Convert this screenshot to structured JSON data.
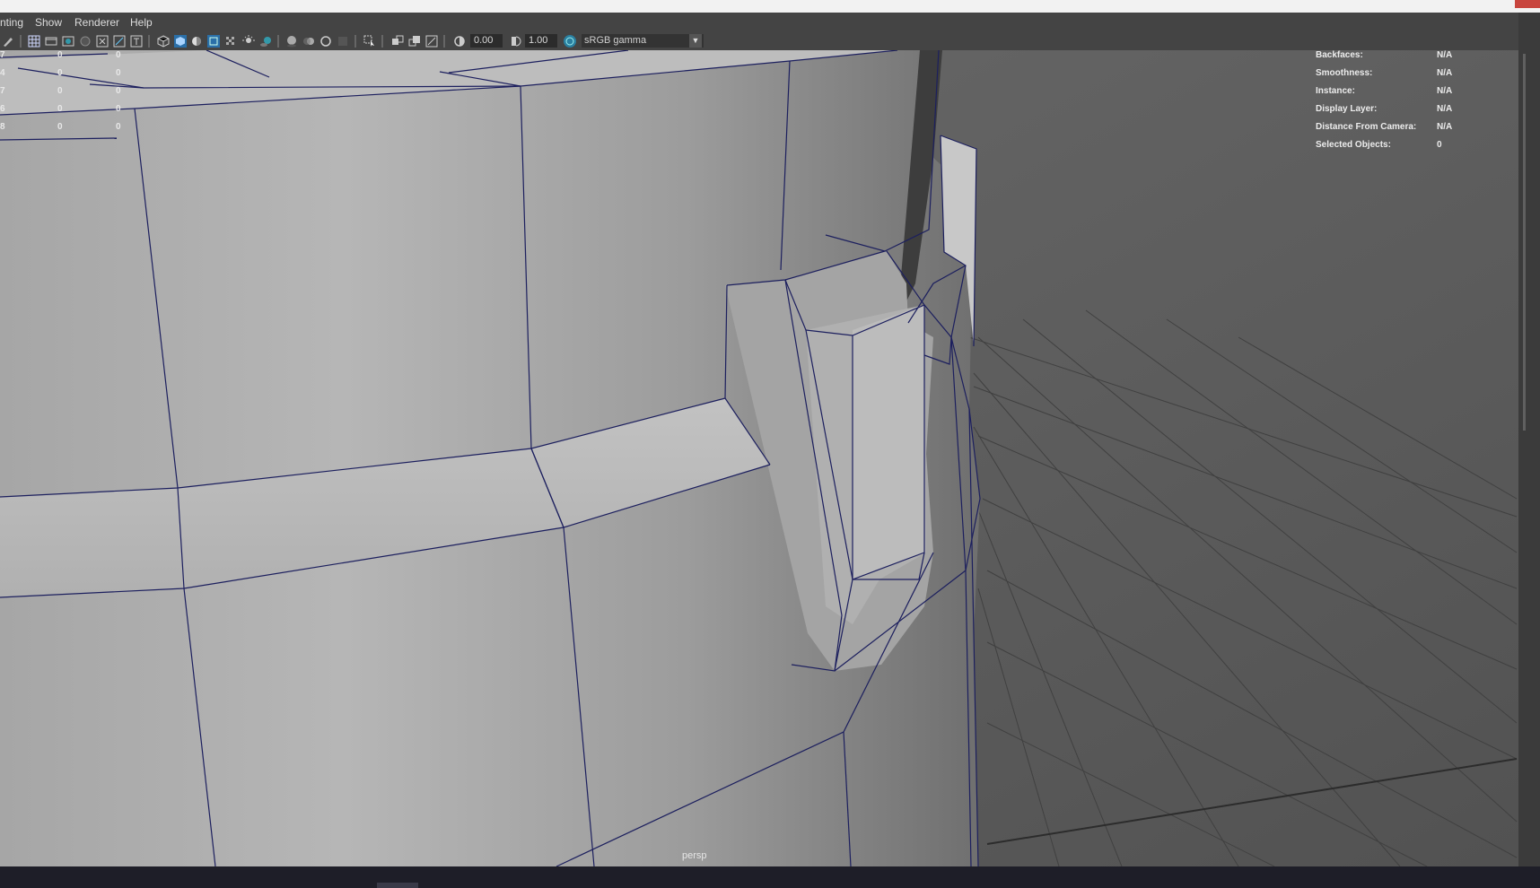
{
  "window": {
    "close_label": ""
  },
  "menubar": {
    "items": [
      {
        "label": "nting"
      },
      {
        "label": "Show"
      },
      {
        "label": "Renderer"
      },
      {
        "label": "Help"
      }
    ]
  },
  "toolbar": {
    "exposure_value": "0.00",
    "gamma_value": "1.00",
    "color_space": "sRGB gamma",
    "icons": [
      "pencil-icon",
      "grid-icon",
      "film-gate-icon",
      "resolution-gate-icon",
      "camera-attr-icon",
      "safe-title-icon",
      "field-chart-icon",
      "xray-icon",
      "wireframe-icon",
      "smooth-shade-icon",
      "default-material-icon",
      "shade-icon",
      "textured-icon",
      "use-lights-icon",
      "shadows-icon",
      "screen-space-ao-icon",
      "motion-blur-icon",
      "antialias-icon",
      "depth-of-field-icon",
      "isolate-select-icon",
      "xray-joints-icon",
      "xray-active-icon",
      "backface-icon",
      "exposure-icon",
      "gamma-icon",
      "color-management-icon"
    ]
  },
  "hud_left": {
    "rows": [
      {
        "a": "7",
        "b": "0",
        "c": "0"
      },
      {
        "a": "4",
        "b": "0",
        "c": "0"
      },
      {
        "a": "7",
        "b": "0",
        "c": "0"
      },
      {
        "a": "6",
        "b": "0",
        "c": "0"
      },
      {
        "a": "8",
        "b": "0",
        "c": "0"
      }
    ]
  },
  "hud_right": {
    "rows": [
      {
        "label": "Backfaces:",
        "value": "N/A"
      },
      {
        "label": "Smoothness:",
        "value": "N/A"
      },
      {
        "label": "Instance:",
        "value": "N/A"
      },
      {
        "label": "Display Layer:",
        "value": "N/A"
      },
      {
        "label": "Distance From Camera:",
        "value": "N/A"
      },
      {
        "label": "Selected Objects:",
        "value": "0"
      }
    ]
  },
  "viewport": {
    "camera": "persp"
  },
  "colors": {
    "wire": "#1c1f5e",
    "background": "#5d5d5d",
    "grid": "#404040"
  }
}
